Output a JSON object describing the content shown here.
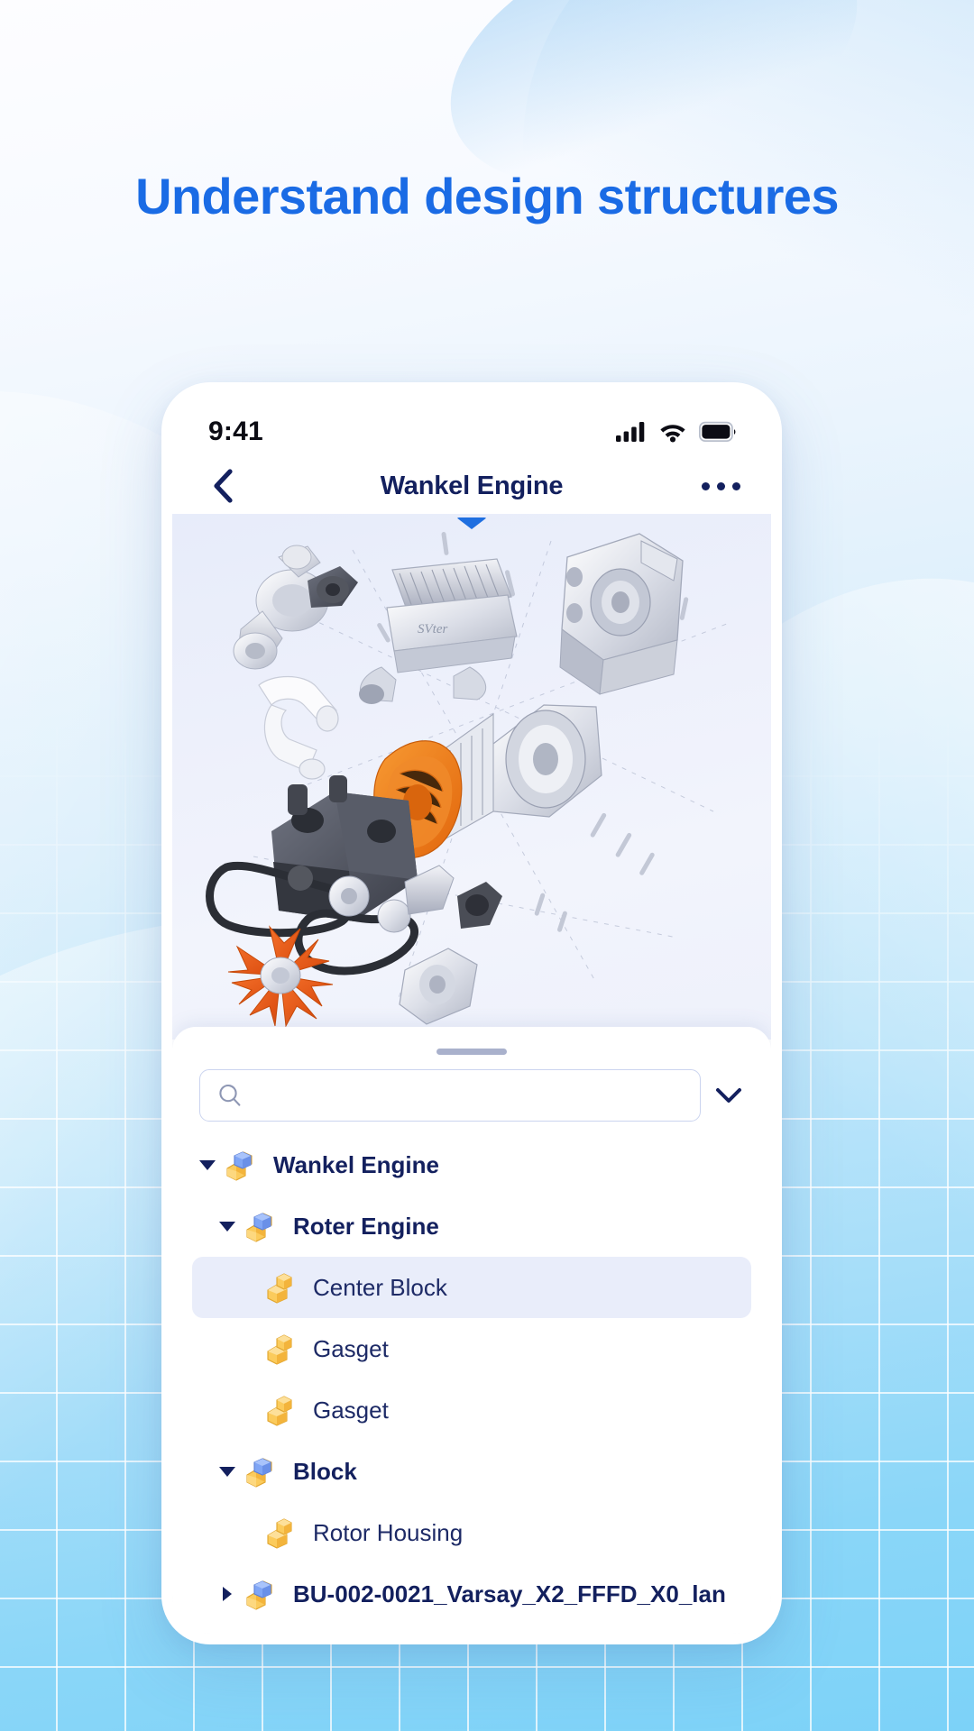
{
  "page": {
    "headline": "Understand design structures"
  },
  "phone": {
    "status": {
      "time": "9:41",
      "icons": [
        "cellular-signal-icon",
        "wifi-icon",
        "battery-icon"
      ]
    },
    "navbar": {
      "back_icon": "chevron-left-icon",
      "title": "Wankel Engine",
      "more_icon": "more-options-icon"
    },
    "viewer": {
      "name": "exploded-3d-model-viewer",
      "collapse_caret_icon": "caret-down-icon",
      "model_title": "Wankel Engine",
      "highlight_color": "#f07818"
    },
    "sheet": {
      "grabber_icon": "drag-handle-icon",
      "search": {
        "icon": "search-icon",
        "value": "",
        "placeholder": ""
      },
      "expand_icon": "chevron-down-icon",
      "tree": [
        {
          "label": "Wankel Engine",
          "indent": 0,
          "toggle": "down",
          "icon": "assembly-icon",
          "bold": true,
          "selected": false
        },
        {
          "label": "Roter Engine",
          "indent": 1,
          "toggle": "down",
          "icon": "assembly-icon",
          "bold": true,
          "selected": false
        },
        {
          "label": "Center Block",
          "indent": 2,
          "toggle": "none",
          "icon": "part-icon",
          "bold": false,
          "selected": true
        },
        {
          "label": "Gasget",
          "indent": 2,
          "toggle": "none",
          "icon": "part-icon",
          "bold": false,
          "selected": false
        },
        {
          "label": "Gasget",
          "indent": 2,
          "toggle": "none",
          "icon": "part-icon",
          "bold": false,
          "selected": false
        },
        {
          "label": "Block",
          "indent": 1,
          "toggle": "down",
          "icon": "assembly-icon",
          "bold": true,
          "selected": false
        },
        {
          "label": "Rotor Housing",
          "indent": 2,
          "toggle": "none",
          "icon": "part-icon",
          "bold": false,
          "selected": false
        },
        {
          "label": "BU-002-0021_Varsay_X2_FFFD_X0_lan",
          "indent": 1,
          "toggle": "right",
          "icon": "assembly-icon",
          "bold": true,
          "selected": false
        }
      ]
    }
  },
  "colors": {
    "headline_blue": "#1a6be5",
    "navy": "#13205e",
    "selected_row": "#e9edfa",
    "accent_orange": "#f07818"
  }
}
